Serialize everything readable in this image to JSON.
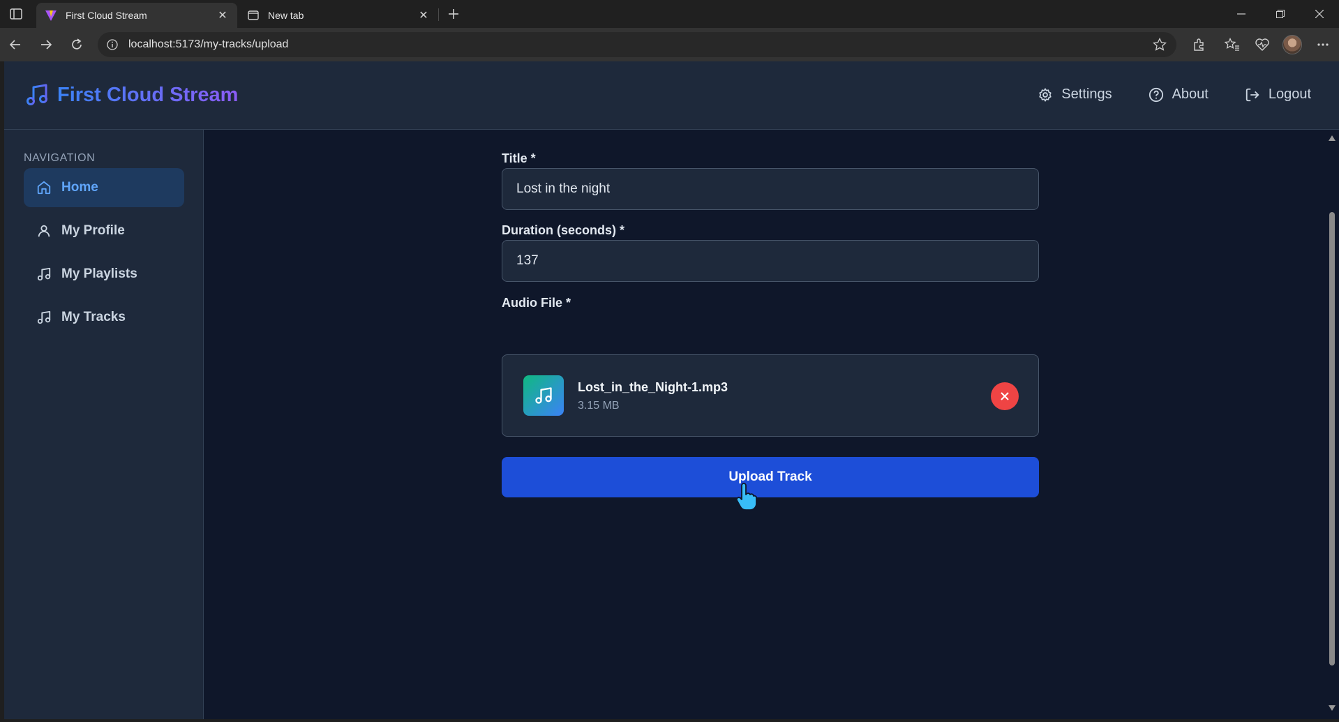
{
  "browser": {
    "tabs": [
      {
        "title": "First Cloud Stream",
        "active": true
      },
      {
        "title": "New tab",
        "active": false
      }
    ],
    "url": "localhost:5173/my-tracks/upload"
  },
  "app": {
    "brand": "First Cloud Stream",
    "header_links": {
      "settings": "Settings",
      "about": "About",
      "logout": "Logout"
    },
    "sidebar": {
      "heading": "NAVIGATION",
      "items": [
        {
          "label": "Home",
          "icon": "home-icon",
          "active": true
        },
        {
          "label": "My Profile",
          "icon": "user-icon",
          "active": false
        },
        {
          "label": "My Playlists",
          "icon": "music-note-icon",
          "active": false
        },
        {
          "label": "My Tracks",
          "icon": "music-note-icon",
          "active": false
        }
      ]
    },
    "form": {
      "title_label": "Title *",
      "title_value": "Lost in the night",
      "duration_label": "Duration (seconds) *",
      "duration_value": "137",
      "audio_label": "Audio File *",
      "file": {
        "name": "Lost_in_the_Night-1.mp3",
        "size": "3.15 MB"
      },
      "submit_label": "Upload Track"
    }
  },
  "colors": {
    "app_bg": "#0f172a",
    "panel_bg": "#1e293b",
    "accent_blue": "#1d4ed8",
    "active_nav": "#60a5fa",
    "remove_red": "#ef4444"
  }
}
